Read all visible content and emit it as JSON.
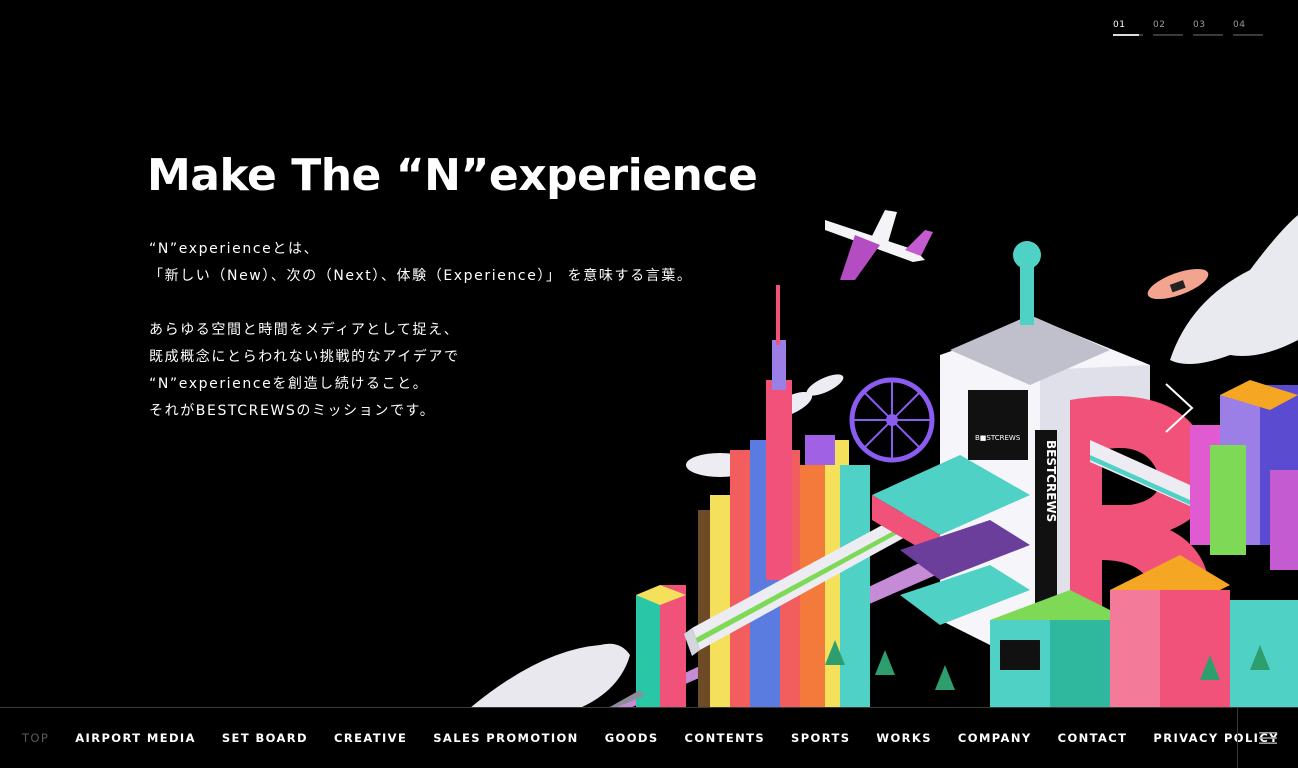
{
  "pager": {
    "items": [
      {
        "label": "01",
        "active": true
      },
      {
        "label": "02",
        "active": false
      },
      {
        "label": "03",
        "active": false
      },
      {
        "label": "04",
        "active": false
      }
    ]
  },
  "hero": {
    "title": "Make The “N”experience",
    "lines": [
      "“N”experienceとは、",
      "「新しい（New）、次の（Next）、体験（Experience）」 を意味する言葉。",
      "",
      "あらゆる空間と時間をメディアとして捉え、",
      "既成概念にとらわれない挑戦的なアイデアで",
      "“N”experienceを創造し続けること。",
      "それがBESTCREWSのミッションです。"
    ]
  },
  "illustration": {
    "sign_text": "BESTCREWS",
    "screen_text": "B■STCREWS"
  },
  "nav": {
    "items": [
      {
        "label": "TOP",
        "muted": true
      },
      {
        "label": "AIRPORT MEDIA"
      },
      {
        "label": "SET BOARD"
      },
      {
        "label": "CREATIVE"
      },
      {
        "label": "SALES PROMOTION"
      },
      {
        "label": "GOODS"
      },
      {
        "label": "CONTENTS"
      },
      {
        "label": "SPORTS"
      },
      {
        "label": "WORKS"
      },
      {
        "label": "COMPANY"
      },
      {
        "label": "CONTACT"
      },
      {
        "label": "PRIVACY POLICY"
      }
    ]
  },
  "colors": {
    "background": "#000000",
    "text": "#ffffff",
    "pink": "#f0527a",
    "teal": "#4fd1c5",
    "purple": "#7b5cd6",
    "orange": "#f5a623",
    "green": "#7ed957"
  },
  "icons": {
    "next": "chevron-right-icon",
    "menu": "hamburger-icon"
  }
}
